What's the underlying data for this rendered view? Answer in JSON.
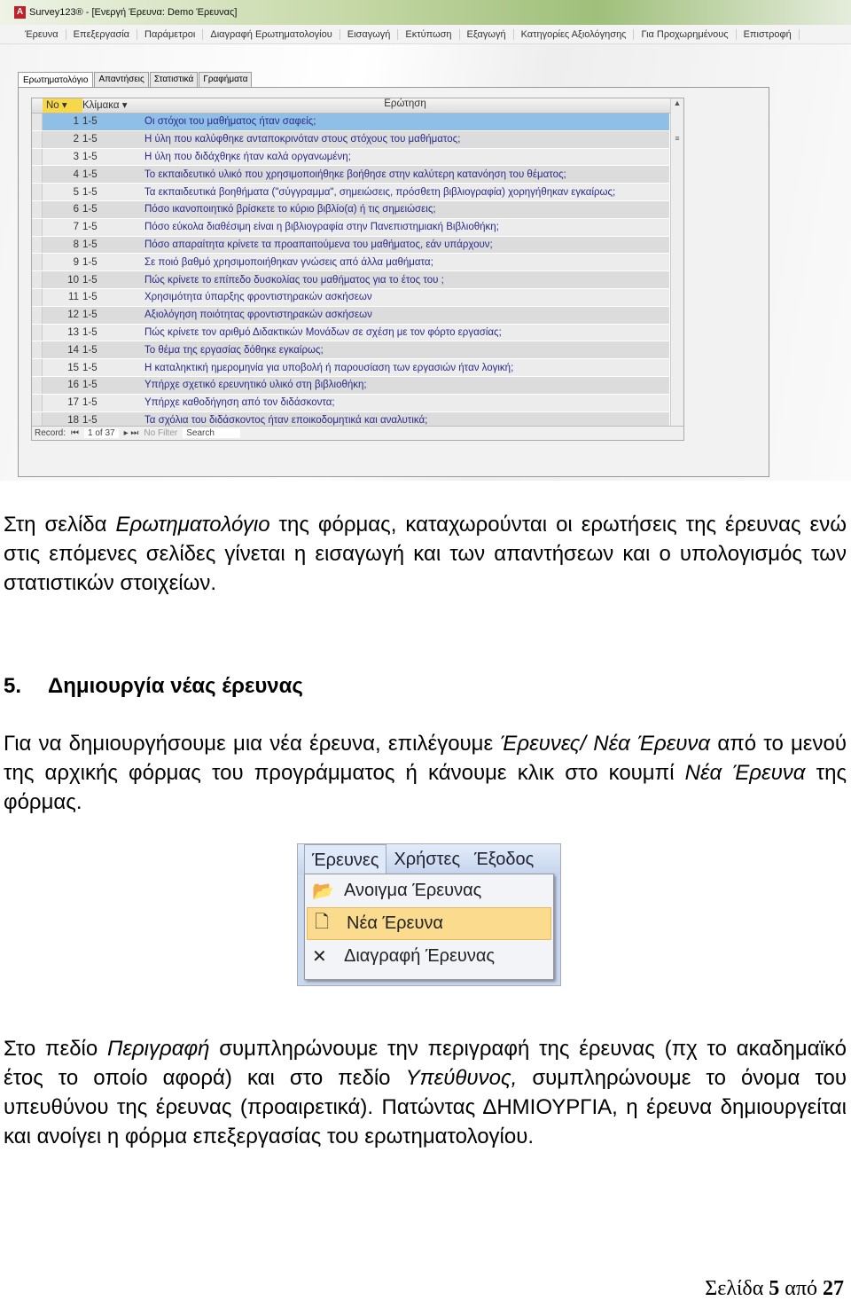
{
  "window": {
    "title": "Survey123® - [Ενεργή Έρευνα: Demo Έρευνας]"
  },
  "menu": [
    "Έρευνα",
    "Επεξεργασία",
    "Παράμετροι",
    "Διαγραφή Ερωτηματολογίου",
    "Εισαγωγή",
    "Εκτύπωση",
    "Εξαγωγή",
    "Κατηγορίες Αξιολόγησης",
    "Για Προχωρημένους",
    "Επιστροφή"
  ],
  "tabs": [
    "Ερωτηματολόγιο",
    "Απαντήσεις",
    "Στατιστικά",
    "Γραφήματα"
  ],
  "grid": {
    "headers": [
      "No",
      "Κλίμακα",
      "Ερώτηση"
    ],
    "rows": [
      [
        "1",
        "1-5",
        "Οι στόχοι του μαθήματος ήταν σαφείς;"
      ],
      [
        "2",
        "1-5",
        "Η ύλη που καλύφθηκε ανταποκρινόταν στους στόχους του μαθήματος;"
      ],
      [
        "3",
        "1-5",
        "Η ύλη που διδάχθηκε ήταν καλά οργανωμένη;"
      ],
      [
        "4",
        "1-5",
        "Το εκπαιδευτικό υλικό που χρησιμοποιήθηκε βοήθησε στην καλύτερη κατανόηση του θέματος;"
      ],
      [
        "5",
        "1-5",
        "Τα εκπαιδευτικά βοηθήματα  (\"σύγγραμμα\", σημειώσεις, πρόσθετη βιβλιογραφία) χορηγήθηκαν εγκαίρως;"
      ],
      [
        "6",
        "1-5",
        "Πόσο ικανοποιητικό βρίσκετε το κύριο βιβλίο(α) ή τις σημειώσεις;"
      ],
      [
        "7",
        "1-5",
        "Πόσο εύκολα διαθέσιμη είναι η βιβλιογραφία στην Πανεπιστημιακή Βιβλιοθήκη;"
      ],
      [
        "8",
        "1-5",
        "Πόσο απαραίτητα κρίνετε τα προαπαιτούμενα του μαθήματος, εάν υπάρχουν;"
      ],
      [
        "9",
        "1-5",
        "Σε ποιό βαθμό χρησιμοποιήθηκαν γνώσεις από άλλα μαθήματα;"
      ],
      [
        "10",
        "1-5",
        "Πώς κρίνετε το επίπεδο δυσκολίας του μαθήματος για το έτος του ;"
      ],
      [
        "11",
        "1-5",
        "Χρησιμότητα ύπαρξης φροντιστηρακών ασκήσεων"
      ],
      [
        "12",
        "1-5",
        "Αξιολόγηση ποιότητας φροντιστηρακών ασκήσεων"
      ],
      [
        "13",
        "1-5",
        "Πώς κρίνετε τον αριθμό Διδακτικών Μονάδων σε σχέση με τον φόρτο εργασίας;"
      ],
      [
        "14",
        "1-5",
        "Το θέμα της εργασίας δόθηκε εγκαίρως;"
      ],
      [
        "15",
        "1-5",
        "Η καταληκτική ημερομηνία για υποβολή ή παρουσίαση των εργασιών ήταν λογική;"
      ],
      [
        "16",
        "1-5",
        "Υπήρχε σχετικό ερευνητικό υλικό στη βιβλιοθήκη;"
      ],
      [
        "17",
        "1-5",
        "Υπήρχε καθοδήγηση από τον διδάσκοντα;"
      ],
      [
        "18",
        "1-5",
        "Τα σχόλια του διδάσκοντος ήταν εποικοδομητικά και αναλυτικά;"
      ]
    ],
    "record_label": "Record:",
    "record_value": "1 of 37",
    "filter": "No Filter",
    "search": "Search"
  },
  "para1": {
    "a": "Στη σελίδα ",
    "b": "Ερωτηματολόγιο",
    "c": " της φόρμας, καταχωρούνται οι ερωτήσεις της έρευνας ενώ στις επόμενες σελίδες γίνεται η εισαγωγή και των απαντήσεων και ο υπολογισμός των στατιστικών στοιχείων."
  },
  "heading": {
    "number": "5.",
    "text": "Δημιουργία νέας έρευνας"
  },
  "para2": {
    "a": "Για να δημιουργήσουμε μια νέα έρευνα, επιλέγουμε ",
    "b": "Έρευνες/ Νέα Έρευνα",
    "c": " από το μενού της αρχικής φόρμας του προγράμματος ή κάνουμε κλικ στο κουμπί ",
    "d": "Νέα Έρευνα",
    "e": " της φόρμας."
  },
  "menu_image": {
    "top": [
      "Έρευνες",
      "Χρήστες",
      "Έξοδος"
    ],
    "items": [
      "Ανοιγμα Έρευνας",
      "Νέα Έρευνα",
      "Διαγραφή Έρευνας"
    ],
    "highlight": "#fbdc8e"
  },
  "para3": {
    "a": "Στο πεδίο ",
    "b": "Περιγραφή",
    "c": " συμπληρώνουμε την περιγραφή της έρευνας (πχ το ακαδημαϊκό έτος το οποίο αφορά) και στο πεδίο ",
    "d": "Υπεύθυνος,",
    "e": " συμπληρώνουμε το όνομα του υπευθύνου της έρευνας (προαιρετικά). Πατώντας ΔΗΜΙΟΥΡΓΙΑ, η έρευνα δημιουργείται και ανοίγει η φόρμα επεξεργασίας του ερωτηματολογίου."
  },
  "footer": {
    "a": "Σελίδα ",
    "page": "5",
    "b": " από ",
    "total": "27"
  }
}
